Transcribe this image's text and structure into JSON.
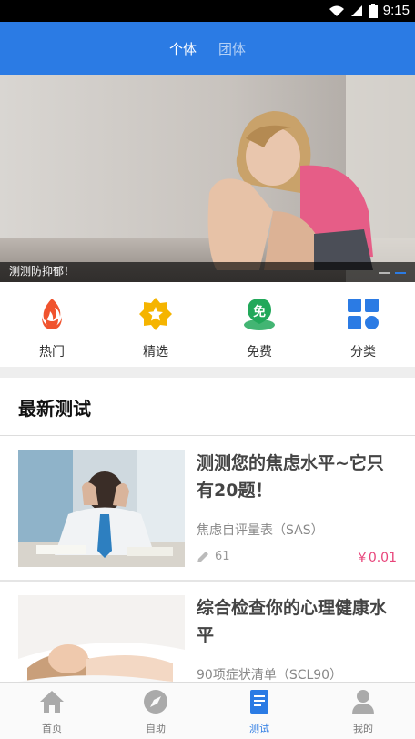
{
  "status_bar": {
    "time": "9:15",
    "battery_icon": "battery-icon",
    "signal_icon": "signal-icon",
    "wifi_icon": "wifi-icon"
  },
  "header": {
    "tabs": [
      {
        "label": "个体",
        "active": true
      },
      {
        "label": "团体",
        "active": false
      }
    ],
    "color": "#2b7be4"
  },
  "banner": {
    "caption": "测测防抑郁！",
    "slides": 2,
    "active_slide": 2
  },
  "categories": [
    {
      "label": "热门",
      "icon": "flame-icon"
    },
    {
      "label": "精选",
      "icon": "star-badge-icon"
    },
    {
      "label": "免费",
      "icon": "free-badge-icon",
      "icon_text": "免"
    },
    {
      "label": "分类",
      "icon": "grid-icon"
    }
  ],
  "section": {
    "title": "最新测试"
  },
  "tests": [
    {
      "title": "测测您的焦虑水平~它只有20题！",
      "subtitle": "焦虑自评量表（SAS）",
      "views": "61",
      "price": "￥0.01"
    },
    {
      "title": "综合检查你的心理健康水平",
      "subtitle": "90项症状清单（SCL90）"
    }
  ],
  "bottom_nav": [
    {
      "label": "首页",
      "icon": "home-icon",
      "active": false
    },
    {
      "label": "自助",
      "icon": "compass-icon",
      "active": false
    },
    {
      "label": "测试",
      "icon": "test-book-icon",
      "active": true
    },
    {
      "label": "我的",
      "icon": "user-icon",
      "active": false
    }
  ],
  "colors": {
    "accent": "#2b7be4",
    "price": "#e8447a",
    "flame": "#f0532e",
    "star": "#f5b400",
    "free": "#22a85a"
  }
}
